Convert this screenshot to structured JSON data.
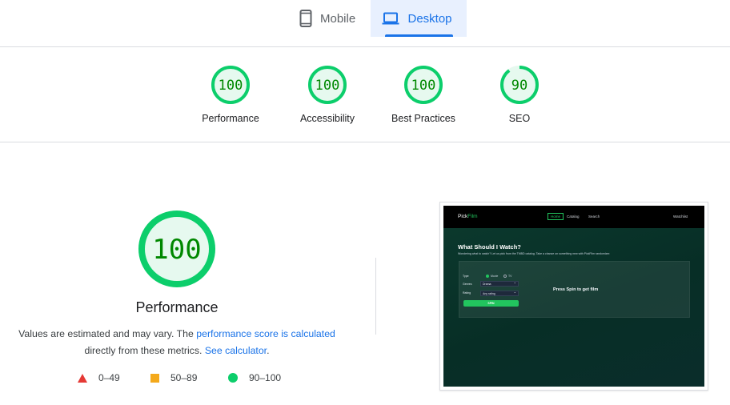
{
  "tabs": {
    "mobile": {
      "label": "Mobile",
      "icon": "mobile-phone-icon"
    },
    "desktop": {
      "label": "Desktop",
      "icon": "laptop-icon",
      "selected": true
    }
  },
  "scores": [
    {
      "label": "Performance",
      "value": "100",
      "fraction": 1.0
    },
    {
      "label": "Accessibility",
      "value": "100",
      "fraction": 1.0
    },
    {
      "label": "Best Practices",
      "value": "100",
      "fraction": 1.0
    },
    {
      "label": "SEO",
      "value": "90",
      "fraction": 0.9
    }
  ],
  "performance": {
    "score": "100",
    "title": "Performance",
    "desc_part1": "Values are estimated and may vary. The ",
    "desc_link1": "performance score is calculated",
    "desc_part2": " directly from these metrics. ",
    "desc_link2": "See calculator",
    "desc_part3": "."
  },
  "legend": [
    {
      "range": "0–49",
      "symbol": "red-triangle"
    },
    {
      "range": "50–89",
      "symbol": "orange-square"
    },
    {
      "range": "90–100",
      "symbol": "green-circle"
    }
  ],
  "colors": {
    "pass": "#0cce6b",
    "pass_fill": "#e6f9ef",
    "pass_text": "#008800",
    "average": "#f4a91b",
    "fail": "#e53935",
    "link": "#1a73e8"
  },
  "screenshot": {
    "logo_part1": "Pick",
    "logo_part2": "Film",
    "nav": {
      "home": "Home",
      "catalog": "Catalog",
      "search": "Search",
      "watchlist": "Watchlist"
    },
    "heading": "What Should I Watch?",
    "subheading": "Wondering what to watch? Let us pick from the TMBD catalog. Take a chance on something new with PickFilm randomizer.",
    "form": {
      "type_label": "Type",
      "type_movie": "Movie",
      "type_tv": "TV",
      "genre_label": "Genres",
      "genre_value": "Drama",
      "rating_label": "Rating",
      "rating_value": "Any rating",
      "spin_label": "SPIN"
    },
    "result_text": "Press Spin to get film"
  }
}
